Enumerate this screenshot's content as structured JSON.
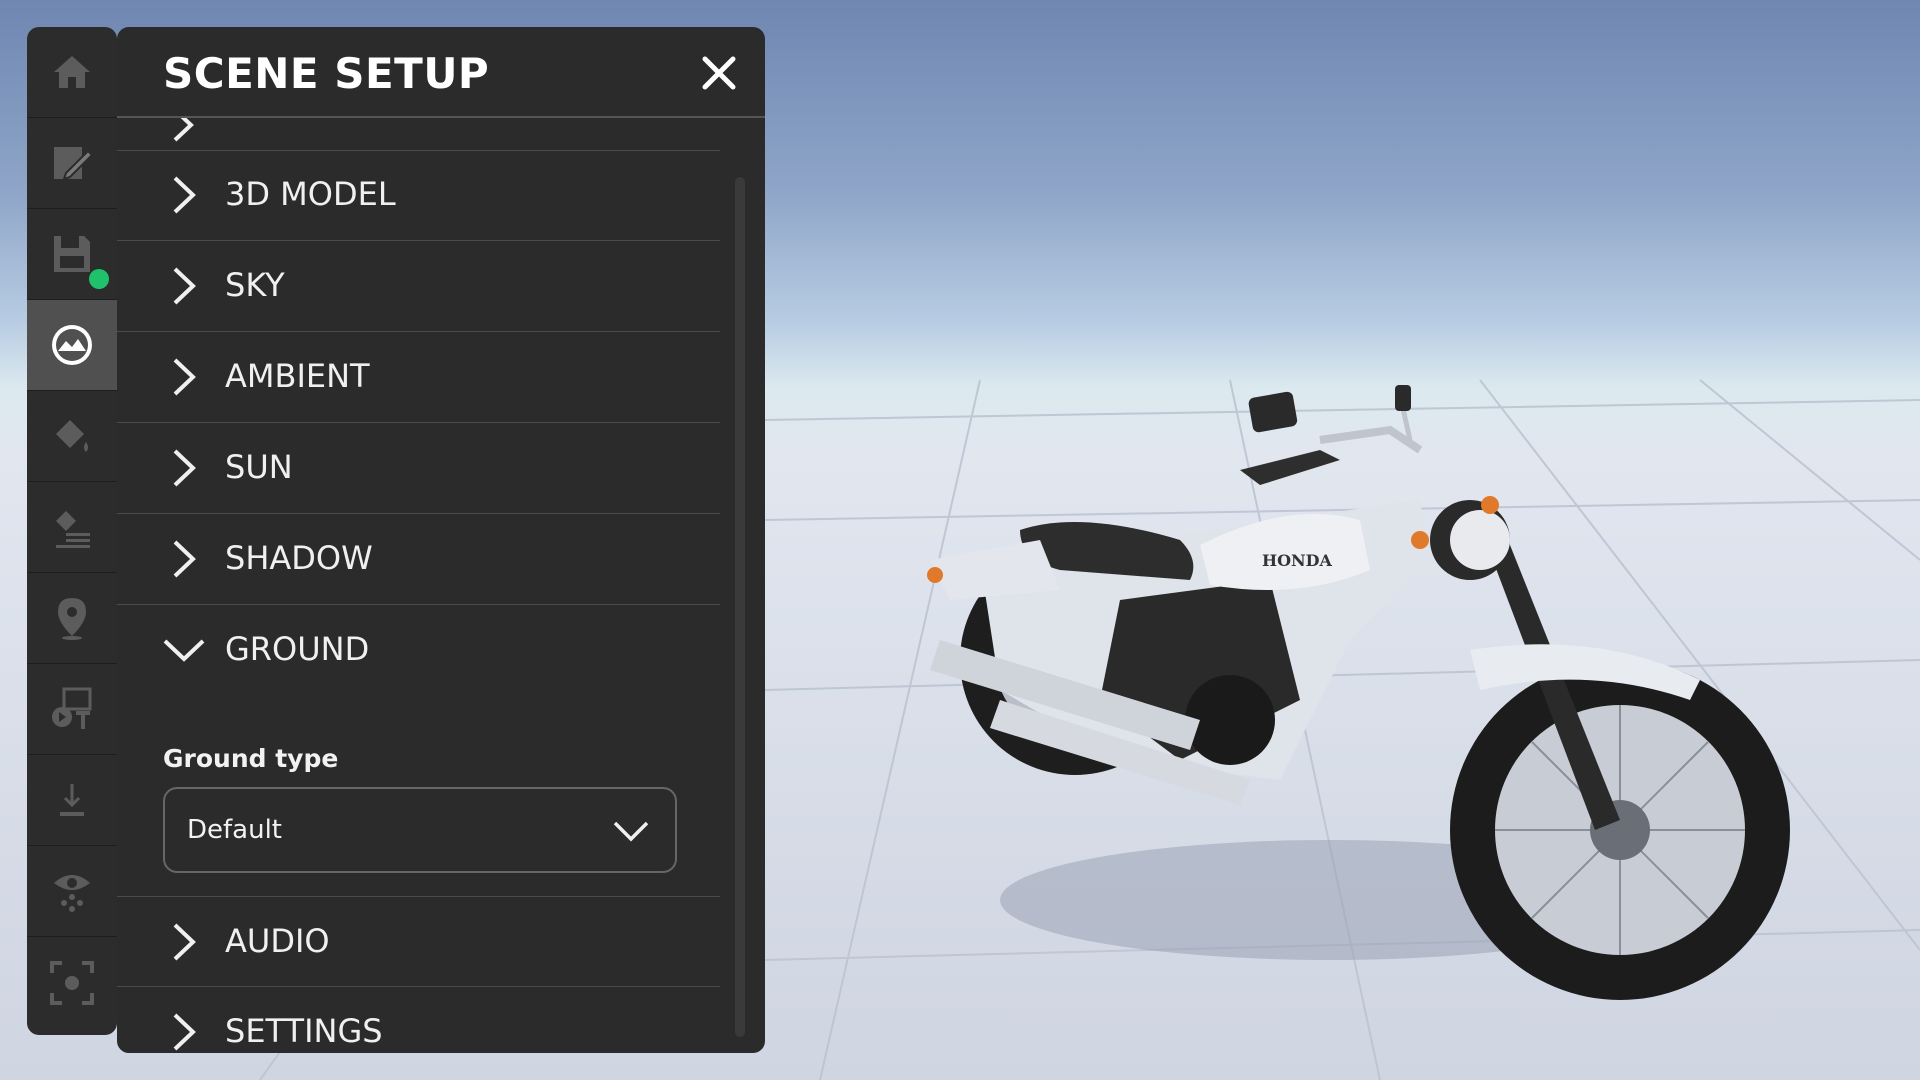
{
  "panel": {
    "title": "SCENE SETUP"
  },
  "rail": {
    "items": [
      {
        "icon": "home-icon"
      },
      {
        "icon": "edit-icon"
      },
      {
        "icon": "save-icon",
        "status": "saved",
        "status_color": "#1fc26a"
      },
      {
        "icon": "environment-icon",
        "active": true
      },
      {
        "icon": "paint-bucket-icon"
      },
      {
        "icon": "material-list-icon"
      },
      {
        "icon": "location-pin-icon"
      },
      {
        "icon": "media-text-icon"
      },
      {
        "icon": "download-icon"
      },
      {
        "icon": "visibility-icon"
      },
      {
        "icon": "focus-frame-icon"
      }
    ]
  },
  "sections": [
    {
      "label": "3D MODEL",
      "expanded": false
    },
    {
      "label": "SKY",
      "expanded": false
    },
    {
      "label": "AMBIENT",
      "expanded": false
    },
    {
      "label": "SUN",
      "expanded": false
    },
    {
      "label": "SHADOW",
      "expanded": false
    },
    {
      "label": "GROUND",
      "expanded": true
    },
    {
      "label": "AUDIO",
      "expanded": false
    },
    {
      "label": "SETTINGS",
      "expanded": false
    }
  ],
  "ground": {
    "type_label": "Ground type",
    "type_value": "Default"
  },
  "viewport": {
    "model_brand": "HONDA"
  },
  "colors": {
    "panel_bg": "#2b2b2b",
    "rail_bg": "#2c2c2c",
    "rail_active": "#505050",
    "text": "#f2f2f2",
    "status_green": "#1fc26a"
  }
}
